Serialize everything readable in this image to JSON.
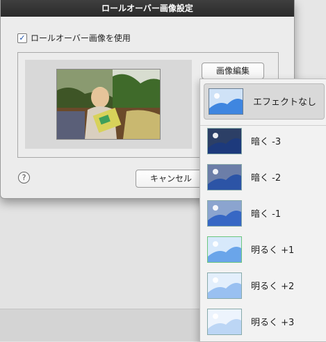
{
  "dialog": {
    "title": "ロールオーバー画像設定",
    "use_checkbox_label": "ロールオーバー画像を使用",
    "use_checkbox_checked": true,
    "edit_button": "画像編集",
    "cancel_button": "キャンセル",
    "help_symbol": "?"
  },
  "menu": {
    "items": [
      {
        "label": "エフェクトなし",
        "selected": true,
        "sky": "#cfe2f7",
        "hill": "#3f86e0"
      },
      {
        "label": "暗く -3",
        "sky": "#2c3f66",
        "hill": "#1d3a7c"
      },
      {
        "label": "暗く -2",
        "sky": "#6c7ea8",
        "hill": "#2c54a6"
      },
      {
        "label": "暗く -1",
        "sky": "#8ba4cf",
        "hill": "#3767c4"
      },
      {
        "label": "明るく +1",
        "sky": "#d7e9fb",
        "hill": "#6aa5ea"
      },
      {
        "label": "明るく +2",
        "sky": "#e3effc",
        "hill": "#99c0f1"
      },
      {
        "label": "明るく +3",
        "sky": "#edf4fd",
        "hill": "#bcd6f5"
      }
    ]
  },
  "colors": {
    "titlebar": "#2f2f2f",
    "checkbox_check": "#1c4fa8",
    "selection_bg": "#d9d9d9"
  }
}
